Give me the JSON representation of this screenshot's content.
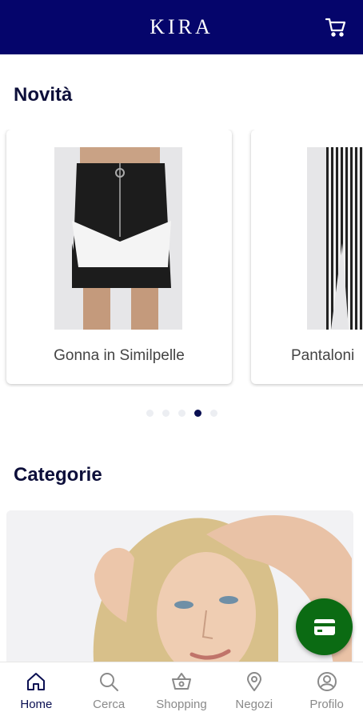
{
  "app": {
    "brand": "KIRA"
  },
  "sections": {
    "new_title": "Novità",
    "categories_title": "Categorie"
  },
  "carousel": {
    "items": [
      {
        "label": "Gonna in Similpelle",
        "image_icon": "skirt-photo"
      },
      {
        "label": "Pantaloni",
        "image_icon": "trousers-photo"
      }
    ],
    "page_count": 5,
    "active_page": 3
  },
  "category_banner": {
    "image_icon": "woman-portrait-photo"
  },
  "fab": {
    "icon": "card-icon",
    "color": "#0b6b13"
  },
  "bottom_nav": {
    "items": [
      {
        "label": "Home",
        "icon": "home-icon"
      },
      {
        "label": "Cerca",
        "icon": "search-icon"
      },
      {
        "label": "Shopping",
        "icon": "basket-icon"
      },
      {
        "label": "Negozi",
        "icon": "location-pin-icon"
      },
      {
        "label": "Profilo",
        "icon": "profile-icon"
      }
    ],
    "active_index": 0
  },
  "colors": {
    "header": "#05056b",
    "title": "#0d0f3a",
    "active_dot": "#0a0f52"
  }
}
